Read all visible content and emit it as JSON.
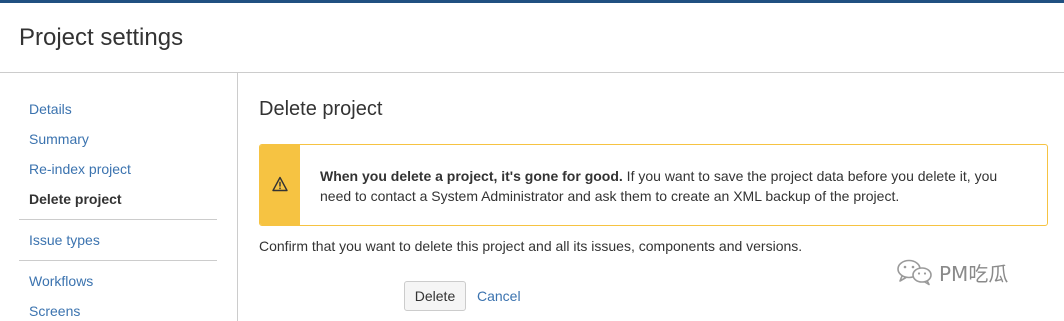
{
  "header": {
    "title": "Project settings"
  },
  "sidebar": {
    "items": [
      {
        "label": "Details"
      },
      {
        "label": "Summary"
      },
      {
        "label": "Re-index project"
      },
      {
        "label": "Delete project",
        "active": true
      },
      {
        "label": "Issue types"
      },
      {
        "label": "Workflows"
      },
      {
        "label": "Screens"
      }
    ]
  },
  "main": {
    "title": "Delete project",
    "warning": {
      "icon": "warning-triangle-icon",
      "bold": "When you delete a project, it's gone for good.",
      "text": " If you want to save the project data before you delete it, you need to contact a System Administrator and ask them to create an XML backup of the project."
    },
    "confirm_text": "Confirm that you want to delete this project and all its issues, components and versions.",
    "delete_label": "Delete",
    "cancel_label": "Cancel"
  },
  "watermark": {
    "icon": "wechat-icon",
    "text": "PM吃瓜"
  },
  "colors": {
    "accent_bar": "#205081",
    "link": "#3b73af",
    "warning": "#f6c342",
    "border": "#cccccc"
  }
}
